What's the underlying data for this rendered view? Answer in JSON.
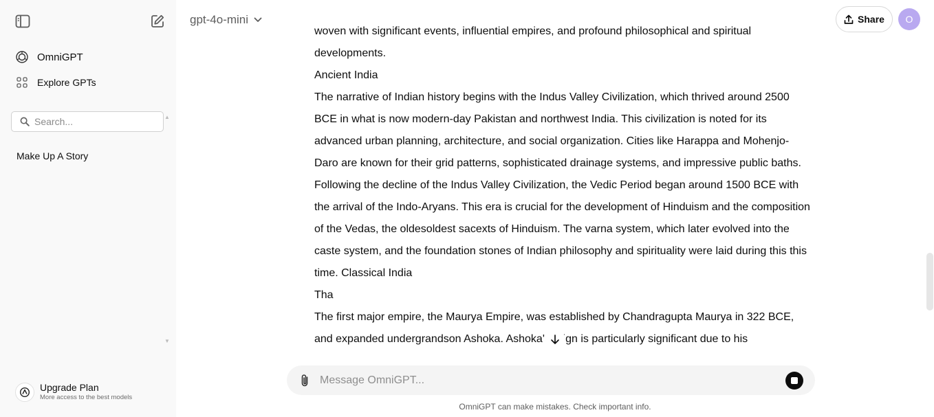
{
  "sidebar": {
    "app_name": "OmniGPT",
    "explore_label": "Explore GPTs",
    "search_placeholder": "Search...",
    "history": [
      {
        "label": "Make Up A Story"
      }
    ],
    "upgrade": {
      "title": "Upgrade Plan",
      "subtitle": "More access to the best models"
    }
  },
  "header": {
    "model_name": "gpt-4o-mini",
    "share_label": "Share",
    "avatar_initial": "O"
  },
  "conversation": {
    "paragraphs": [
      "woven with significant events, influential empires, and profound philosophical and spiritual developments.",
      "Ancient India",
      "The narrative of Indian history begins with the Indus Valley Civilization, which thrived around 2500 BCE in what is now modern-day Pakistan and northwest India. This civilization is noted for its advanced urban planning, architecture, and social organization. Cities like Harappa and Mohenjo-Daro are known for their grid patterns, sophisticated drainage systems, and impressive public baths.",
      "Following the decline of the Indus Valley Civilization, the Vedic Period began around 1500 BCE with the arrival of the Indo-Aryans. This era is crucial for the development of Hinduism and the composition of the Vedas, the oldesoldest sacexts of Hinduism. The varna system, which later evolved into the caste system, and the foundation stones of Indian philosophy and spirituality were laid during this this time. Classical India",
      "Tha",
      "The first major empire, the Maurya Empire, was established by Chandragupta Maurya in 322 BCE, and expanded undergrandson Ashoka. Ashoka's reign is particularly significant due to his"
    ]
  },
  "composer": {
    "placeholder": "Message OmniGPT..."
  },
  "footer": {
    "disclaimer": "OmniGPT can make mistakes. Check important info."
  },
  "icons": {
    "sidebar_toggle": "sidebar-toggle-icon",
    "new_chat": "new-chat-icon",
    "omnigpt_logo": "openai-logo-icon",
    "explore": "grid-icon",
    "search": "search-icon",
    "chevron": "chevron-down-icon",
    "share": "share-upload-icon",
    "scroll_down": "arrow-down-icon",
    "attach": "paperclip-icon",
    "stop": "stop-icon",
    "upgrade": "upgrade-logo-icon"
  },
  "colors": {
    "sidebar_bg": "#f9f9f9",
    "avatar_bg": "#b9a9f0",
    "composer_bg": "#f4f4f4",
    "stop_button": "#0d0d0d"
  }
}
